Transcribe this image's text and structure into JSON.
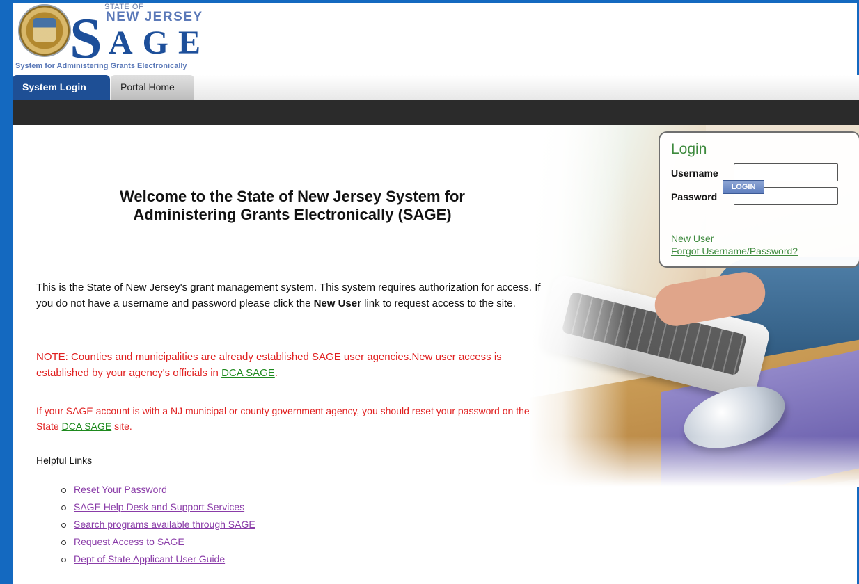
{
  "header": {
    "logo_state_of": "STATE OF",
    "logo_new_jersey": "NEW JERSEY",
    "logo_s": "S",
    "logo_age": "AGE",
    "logo_tagline": "System for Administering Grants Electronically"
  },
  "tabs": [
    {
      "label": "System Login",
      "active": true
    },
    {
      "label": "Portal Home",
      "active": false
    }
  ],
  "login": {
    "title": "Login",
    "username_label": "Username",
    "password_label": "Password",
    "username_value": "",
    "password_value": "",
    "button_label": "LOGIN",
    "new_user_link": "New User",
    "forgot_link": "Forgot Username/Password?"
  },
  "main": {
    "welcome_line1": "Welcome to the State of New Jersey System for",
    "welcome_line2": "Administering Grants Electronically (SAGE)",
    "intro_part1": "This is the State of New Jersey's grant management system. This system requires authorization for access. If you do not have a username and password please click the ",
    "intro_bold": "New User",
    "intro_part2": " link to request access to the site.",
    "note1_text": "NOTE: Counties and municipalities are already established SAGE user agencies.New user access is established by your agency's officials in ",
    "note1_link": "DCA SAGE",
    "note1_end": ".",
    "note2_text": "If your SAGE account is with a NJ municipal or county government agency, you should reset your password on the State ",
    "note2_link": "DCA SAGE",
    "note2_end": " site.",
    "helpful_title": "Helpful Links",
    "helpful_links": [
      "Reset Your Password",
      "SAGE Help Desk and Support Services",
      "Search programs available through SAGE",
      "Request Access to SAGE",
      "Dept of State Applicant User Guide"
    ]
  },
  "colors": {
    "frame": "#1469c0",
    "tab_active": "#1e4f95",
    "navbar": "#2b2b2b",
    "login_title": "#3e8a3e",
    "note_red": "#e02020",
    "link_purple": "#8a3ca8"
  }
}
